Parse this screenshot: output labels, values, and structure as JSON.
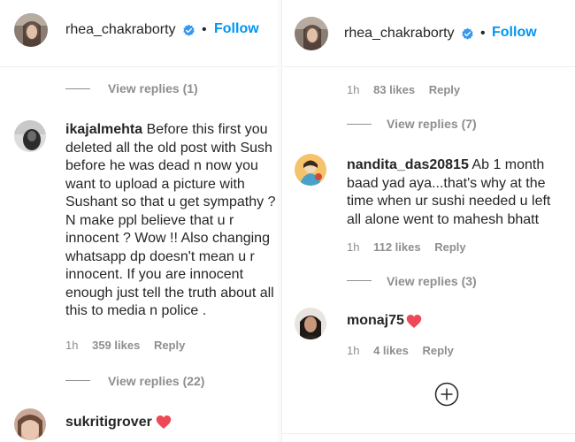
{
  "left": {
    "header": {
      "username": "rhea_chakraborty",
      "dot": "•",
      "follow": "Follow"
    },
    "view_replies_1": "View replies (1)",
    "comment_1": {
      "username": "ikajalmehta",
      "text": "Before this first you deleted all the old post with Sush before he was dead n now you want to upload a picture with Sushant so that u get sympathy ? N make ppl believe that u r innocent ? Wow !! Also changing whatsapp dp doesn't mean u r innocent. If you are innocent enough just tell the truth about all this to media n police .",
      "time": "1h",
      "likes": "359 likes",
      "reply": "Reply"
    },
    "view_replies_2": "View replies (22)",
    "comment_2": {
      "username": "sukritigrover"
    }
  },
  "right": {
    "header": {
      "username": "rhea_chakraborty",
      "dot": "•",
      "follow": "Follow"
    },
    "meta_top": {
      "time": "1h",
      "likes": "83 likes",
      "reply": "Reply"
    },
    "view_replies_1": "View replies (7)",
    "comment_1": {
      "username": "nandita_das20815",
      "text": "Ab 1 month baad yad aya...that's why at the time when ur sushi needed u left all alone went to mahesh bhatt",
      "time": "1h",
      "likes": "112 likes",
      "reply": "Reply"
    },
    "view_replies_2": "View replies (3)",
    "comment_2": {
      "username": "monaj75",
      "time": "1h",
      "likes": "4 likes",
      "reply": "Reply"
    }
  },
  "colors": {
    "link": "#0095f6",
    "muted": "#8e8e8e",
    "text": "#262626",
    "heart": "#ed4956",
    "verified": "#3897f0"
  },
  "icons": [
    "verified-badge-icon",
    "heart-icon",
    "add-circle-icon"
  ]
}
